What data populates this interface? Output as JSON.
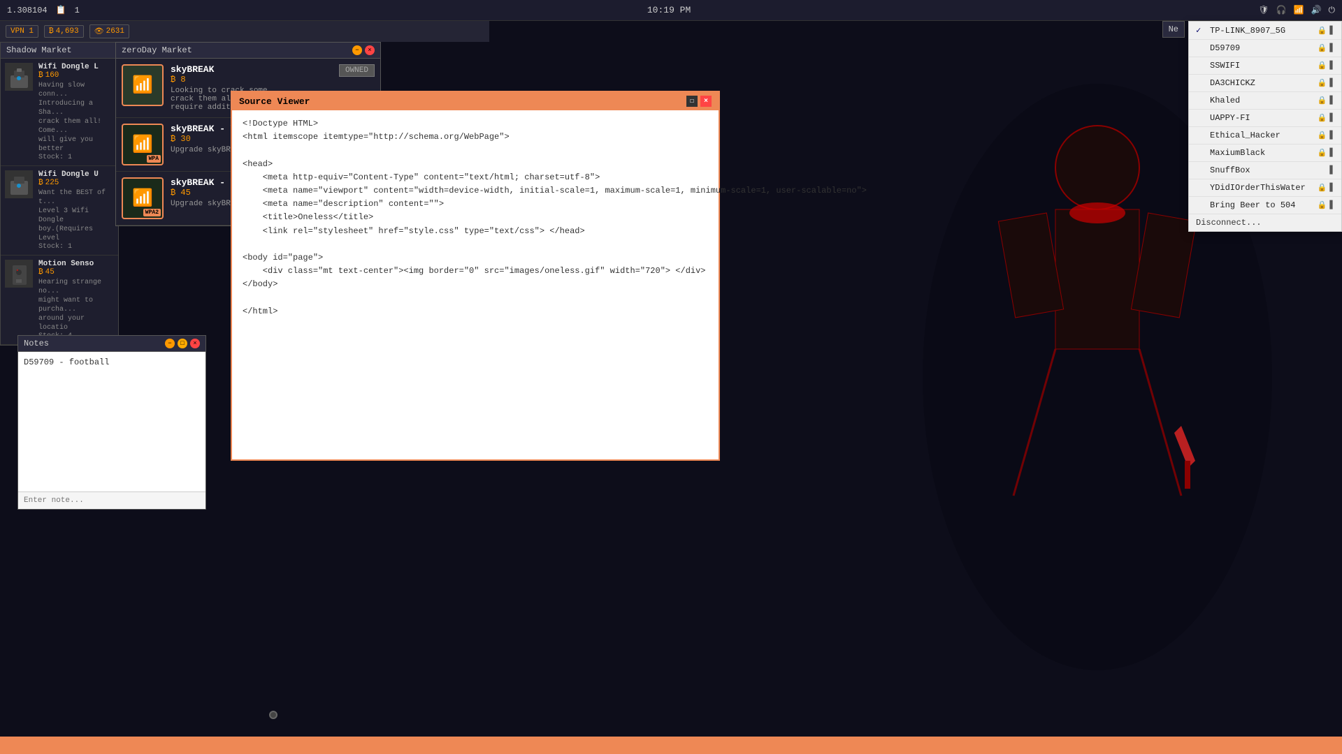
{
  "system": {
    "id": "1.308104",
    "book_icon": "📋",
    "book_count": "1",
    "time": "10:19 PM",
    "vpn_label": "VPN 1",
    "currency1_icon": "₿",
    "currency1_value": "4,693",
    "currency2_icon": "👁",
    "currency2_value": "2631"
  },
  "top_right_buttons": {
    "new_label": "Ne"
  },
  "shadow_market": {
    "title": "Shadow Market",
    "items": [
      {
        "name": "Wifi Dongle L",
        "price": "160",
        "desc": "Having slow conn... introducing a Sha... crack them all! Come... will give you better",
        "stock": "Stock: 1"
      },
      {
        "name": "Wifi Dongle U",
        "price": "225",
        "desc": "Want the BEST of t... Level 3 Wifi Dongle boy.(Requires Level",
        "stock": "Stock: 1"
      },
      {
        "name": "Motion Senso",
        "price": "45",
        "desc": "Hearing strange no... might want to purcha... around your locatio",
        "stock": "Stock: 4"
      }
    ]
  },
  "zero_day_market": {
    "title": "zeroDay Market",
    "items": [
      {
        "name": "skyBREAK",
        "price": "8",
        "desc": "Looking to crack some... crack them all! Come... require additional libr...",
        "owned": "OWNED",
        "badge": ""
      },
      {
        "name": "skyBREAK - W",
        "price": "30",
        "desc": "Upgrade skyBREAK w...",
        "badge": "WPA"
      },
      {
        "name": "skyBREAK - W",
        "price": "45",
        "desc": "Upgrade skyBREAK w...",
        "badge": "WPA2"
      }
    ]
  },
  "source_viewer": {
    "title": "Source Viewer",
    "content": "<!Doctype HTML>\n<html itemscope itemtype=\"http://schema.org/WebPage\">\n\n<head>\n    <meta http-equiv=\"Content-Type\" content=\"text/html; charset=utf-8\">\n    <meta name=\"viewport\" content=\"width=device-width, initial-scale=1, maximum-scale=1, minimum-scale=1, user-scalable=no\">\n    <meta name=\"description\" content=\"\">\n    <title>Oneless</title>\n    <link rel=\"stylesheet\" href=\"style.css\" type=\"text/css\"> </head>\n\n<body id=\"page\">\n    <div class=\"mt text-center\"><img border=\"0\" src=\"images/oneless.gif\" width=\"720\"> </div>\n</body>\n\n</html>"
  },
  "notes": {
    "title": "Notes",
    "content": "D59709 - football",
    "placeholder": "Enter note..."
  },
  "wifi_menu": {
    "networks": [
      {
        "name": "TP-LINK_8907_5G",
        "locked": true,
        "signal": true,
        "active": true
      },
      {
        "name": "D59709",
        "locked": true,
        "signal": true,
        "active": false
      },
      {
        "name": "SSWIFI",
        "locked": true,
        "signal": true,
        "active": false
      },
      {
        "name": "DA3CHICKZ",
        "locked": true,
        "signal": true,
        "active": false
      },
      {
        "name": "Khaled",
        "locked": true,
        "signal": true,
        "active": false
      },
      {
        "name": "UAPPY-FI",
        "locked": true,
        "signal": true,
        "active": false
      },
      {
        "name": "Ethical_Hacker",
        "locked": true,
        "signal": true,
        "active": false
      },
      {
        "name": "MaxiumBlack",
        "locked": true,
        "signal": true,
        "active": false
      },
      {
        "name": "SnuffBox",
        "locked": false,
        "signal": true,
        "active": false
      },
      {
        "name": "YDidIOrderThisWater",
        "locked": true,
        "signal": true,
        "active": false
      },
      {
        "name": "Bring Beer to 504",
        "locked": true,
        "signal": true,
        "active": false
      }
    ],
    "disconnect_label": "Disconnect..."
  }
}
